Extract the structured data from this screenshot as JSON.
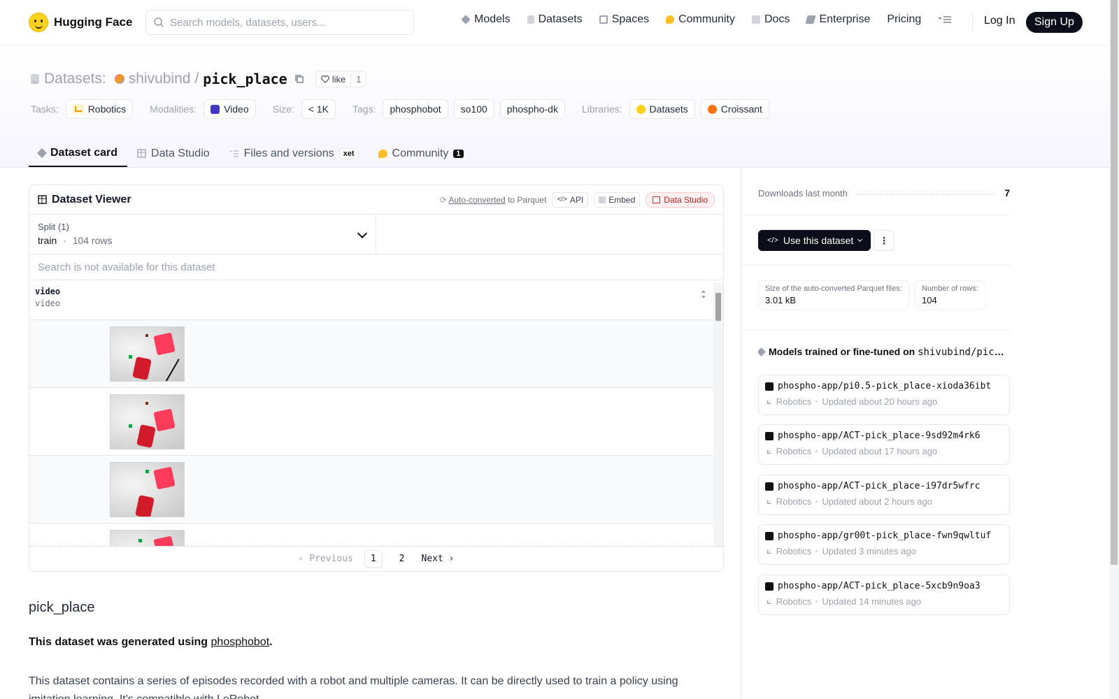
{
  "nav": {
    "brand": "Hugging Face",
    "search_placeholder": "Search models, datasets, users...",
    "items": [
      {
        "label": "Models",
        "icon": "cube-icon",
        "color": "#6b7280"
      },
      {
        "label": "Datasets",
        "icon": "database-icon",
        "color": "#9ca3af"
      },
      {
        "label": "Spaces",
        "icon": "grid-icon",
        "color": "#9ca3af"
      },
      {
        "label": "Community",
        "icon": "chat-icon",
        "color": "#fbbf24"
      },
      {
        "label": "Docs",
        "icon": "book-icon",
        "color": "#9ca3af"
      },
      {
        "label": "Enterprise",
        "icon": "lock-icon",
        "color": "#6b7280"
      },
      {
        "label": "Pricing",
        "icon": "",
        "color": ""
      }
    ],
    "login": "Log In",
    "signup": "Sign Up"
  },
  "header": {
    "type_label": "Datasets:",
    "owner": "shivubind",
    "separator": "/",
    "repo_name": "pick_place",
    "like_label": "like",
    "like_count": "1",
    "meta": {
      "tasks_label": "Tasks:",
      "task": "Robotics",
      "modalities_label": "Modalities:",
      "modality": "Video",
      "size_label": "Size:",
      "size": "< 1K",
      "tags_label": "Tags:",
      "tags": [
        "phosphobot",
        "so100",
        "phospho-dk"
      ],
      "libraries_label": "Libraries:",
      "libraries": [
        "Datasets",
        "Croissant"
      ]
    }
  },
  "tabs": [
    {
      "label": "Dataset card",
      "active": true
    },
    {
      "label": "Data Studio",
      "active": false
    },
    {
      "label": "Files and versions",
      "badge": "xet",
      "active": false
    },
    {
      "label": "Community",
      "badge": "1",
      "active": false
    }
  ],
  "viewer": {
    "title": "Dataset Viewer",
    "auto_converted": "Auto-converted",
    "to_parquet": "to Parquet",
    "api": "API",
    "embed": "Embed",
    "data_studio": "Data Studio",
    "split_label": "Split (1)",
    "split_name": "train",
    "split_sep": "·",
    "split_rows": "104 rows",
    "search_na": "Search is not available for this dataset",
    "column_name": "video",
    "column_type": "video",
    "pager": {
      "prev": "Previous",
      "pages": [
        "1",
        "2"
      ],
      "current": "1",
      "next": "Next"
    }
  },
  "readme": {
    "heading": "pick_place",
    "bold_prefix": "This dataset was generated using ",
    "bold_link": "phosphobot",
    "bold_suffix": ".",
    "paragraph": "This dataset contains a series of episodes recorded with a robot and multiple cameras. It can be directly used to train a policy using imitation learning. It's compatible with LeRobot."
  },
  "sidebar": {
    "downloads_label": "Downloads last month",
    "downloads_value": "7",
    "use_button": "Use this dataset",
    "stats": [
      {
        "label": "Size of the auto-converted Parquet files:",
        "value": "3.01 kB"
      },
      {
        "label": "Number of rows:",
        "value": "104"
      }
    ],
    "models_title": "Models trained or fine-tuned on",
    "models_repo": "shivubind/pick_place",
    "models": [
      {
        "name": "phospho-app/pi0.5-pick_place-xioda36ibt",
        "task": "Robotics",
        "updated": "Updated about 20 hours ago"
      },
      {
        "name": "phospho-app/ACT-pick_place-9sd92m4rk6",
        "task": "Robotics",
        "updated": "Updated about 17 hours ago"
      },
      {
        "name": "phospho-app/ACT-pick_place-i97dr5wfrc",
        "task": "Robotics",
        "updated": "Updated about 2 hours ago"
      },
      {
        "name": "phospho-app/gr00t-pick_place-fwn9qwltuf",
        "task": "Robotics",
        "updated": "Updated 3 minutes ago"
      },
      {
        "name": "phospho-app/ACT-pick_place-5xcb9n9oa3",
        "task": "Robotics",
        "updated": "Updated 14 minutes ago"
      }
    ]
  }
}
